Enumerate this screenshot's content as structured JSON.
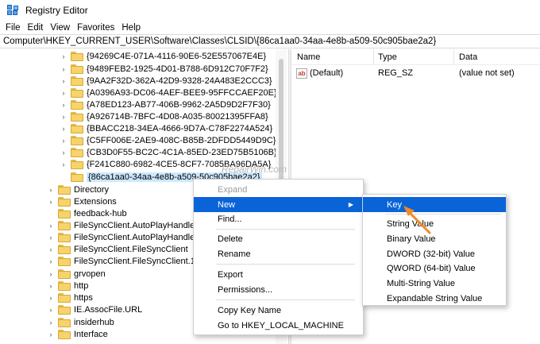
{
  "window": {
    "title": "Registry Editor"
  },
  "menubar": [
    "File",
    "Edit",
    "View",
    "Favorites",
    "Help"
  ],
  "address": "Computer\\HKEY_CURRENT_USER\\Software\\Classes\\CLSID\\{86ca1aa0-34aa-4e8b-a509-50c905bae2a2}",
  "tree": {
    "clsid_children": [
      "{94269C4E-071A-4116-90E6-52E557067E4E}",
      "{9489FEB2-1925-4D01-B788-6D912C70F7F2}",
      "{9AA2F32D-362A-42D9-9328-24A483E2CCC3}",
      "{A0396A93-DC06-4AEF-BEE9-95FFCCAEF20E}",
      "{A78ED123-AB77-406B-9962-2A5D9D2F7F30}",
      "{A926714B-7BFC-4D08-A035-80021395FFA8}",
      "{BBACC218-34EA-4666-9D7A-C78F2274A524}",
      "{C5FF006E-2AE9-408C-B85B-2DFDD5449D9C}",
      "{CB3D0F55-BC2C-4C1A-85ED-23ED75B5106B}",
      "{F241C880-6982-4CE5-8CF7-7085BA96DA5A}",
      "{86ca1aa0-34aa-4e8b-a509-50c905bae2a2}"
    ],
    "class_keys": [
      "Directory",
      "Extensions",
      "feedback-hub",
      "FileSyncClient.AutoPlayHandler",
      "FileSyncClient.AutoPlayHandler.1",
      "FileSyncClient.FileSyncClient",
      "FileSyncClient.FileSyncClient.1",
      "grvopen",
      "http",
      "https",
      "IE.AssocFile.URL",
      "insiderhub",
      "Interface"
    ]
  },
  "list": {
    "headers": {
      "name": "Name",
      "type": "Type",
      "data": "Data"
    },
    "rows": [
      {
        "name": "(Default)",
        "type": "REG_SZ",
        "data": "(value not set)"
      }
    ]
  },
  "context_menu": {
    "items": [
      "Expand",
      "New",
      "Find...",
      "Delete",
      "Rename",
      "Export",
      "Permissions...",
      "Copy Key Name",
      "Go to HKEY_LOCAL_MACHINE"
    ]
  },
  "submenu": {
    "items": [
      "Key",
      "String Value",
      "Binary Value",
      "DWORD (32-bit) Value",
      "QWORD (64-bit) Value",
      "Multi-String Value",
      "Expandable String Value"
    ]
  },
  "watermark": "RepairWin.com",
  "colors": {
    "highlight": "#0a64d8",
    "selection": "#cce8ff",
    "arrow": "#f08a24"
  }
}
